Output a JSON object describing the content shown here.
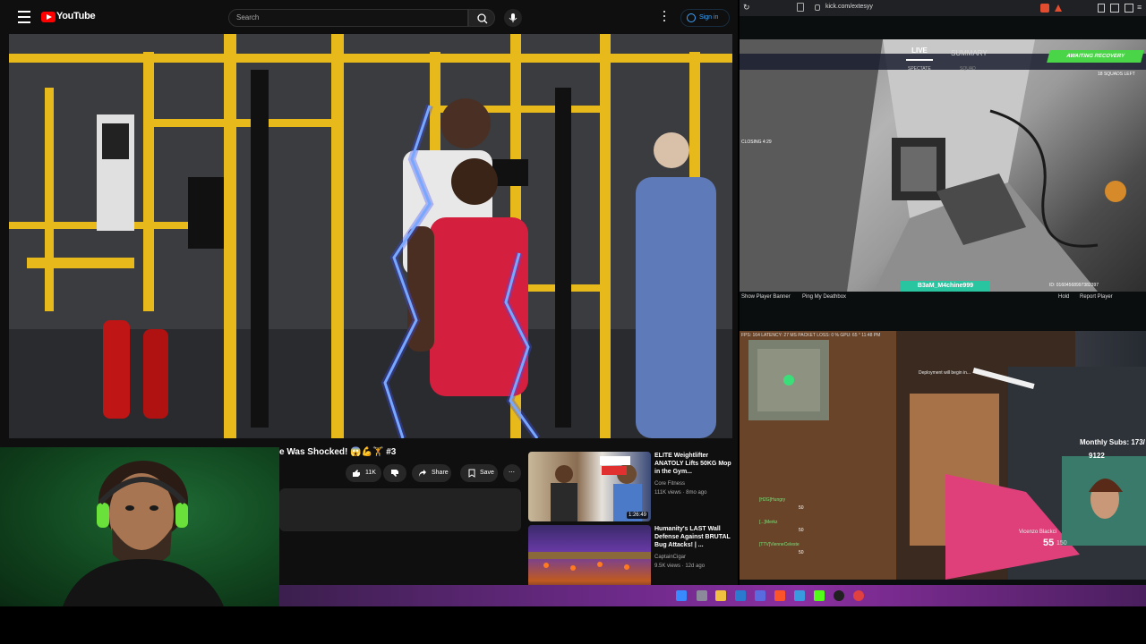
{
  "youtube": {
    "brand": "YouTube",
    "search_placeholder": "Search",
    "sign_in": "Sign in",
    "video_title": "e Was Shocked! 😱💪🏋️ #3",
    "likes": "11K",
    "share": "Share",
    "save": "Save",
    "recommendations": [
      {
        "title": "ELITE Weightlifter ANATOLY Lifts 50KG Mop in the Gym... ",
        "channel": "Core Fitness",
        "meta": "111K views · 8mo ago",
        "duration": "1:26:49",
        "thumb_text": "SAY IT AGAIN... SORRY"
      },
      {
        "title": "Humanity's LAST Wall Defense Against BRUTAL Bug Attacks! | ...",
        "channel": "CaptainCigar",
        "meta": "9.5K views · 12d ago",
        "duration": "",
        "thumb_text": ""
      }
    ]
  },
  "browser": {
    "url": "kick.com/extesyy"
  },
  "stream1": {
    "tab_live": "LIVE",
    "tab_summary": "SUMMARY",
    "sub_left": "SPECTATE",
    "sub_right": "SQUAD",
    "status": "AWAITING RECOVERY",
    "squads_left": "18 SQUADS LEFT",
    "closing": "CLOSING   4:29",
    "player_name": "B3aM_M4chine999",
    "hint_left": "Show Player Banner",
    "hint_mid": "Ping My Deathbox",
    "hint_right": "Report Player",
    "hint_right_key": "Hold",
    "id_text": "ID: 01604568997382397"
  },
  "stream2": {
    "stats": "FPS: 164  LATENCY: 27 MS  PACKET LOSS: 0 %  GPU: 65 °  11:48 PM",
    "deploy": "Deployment will begin in...",
    "monthly_subs": "Monthly Subs: 173/",
    "sub_count": "9122",
    "ammo": "55",
    "ammo_reserve": "150",
    "killfeed": "Vicenzo Blackci",
    "team": [
      "[H2G]Hungry",
      "[...]Merkz",
      "[TTV]VienneCeleste"
    ],
    "team_vals": [
      "50",
      "50",
      "50"
    ]
  },
  "colors": {
    "youtube_red": "#ff0000",
    "link_blue": "#3ea6ff",
    "kick_green": "#4ad447",
    "badge_teal": "#29c4a0",
    "taskbar_purple": "#6e2a8a"
  }
}
